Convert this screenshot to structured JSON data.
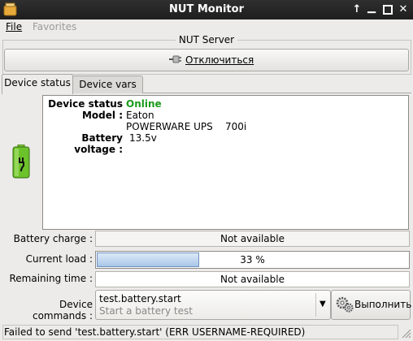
{
  "window": {
    "title": "NUT Monitor"
  },
  "menu": {
    "file": "File",
    "favorites": "Favorites"
  },
  "server": {
    "legend": "NUT Server",
    "disconnect_label": "Отключиться"
  },
  "tabs": [
    {
      "label": "Device status",
      "active": true
    },
    {
      "label": "Device vars",
      "active": false
    }
  ],
  "status": {
    "device_status_label": "Device status :",
    "device_status_value": "Online",
    "model_label": "Model :",
    "model_line1": "Eaton",
    "model_line2": "POWERWARE UPS    700i",
    "battery_voltage_label": "Battery voltage :",
    "battery_voltage_value": "13.5v"
  },
  "rows": {
    "battery_charge_label": "Battery charge :",
    "battery_charge_value": "Not available",
    "current_load_label": "Current load :",
    "current_load_value": "33 %",
    "current_load_percent": 33,
    "remaining_time_label": "Remaining time :",
    "remaining_time_value": "Not available",
    "device_commands_label": "Device commands :"
  },
  "command": {
    "name": "test.battery.start",
    "description": "Start a battery test",
    "execute_label": "Выполнить"
  },
  "statusbar": {
    "text": "Failed to send 'test.battery.start' (ERR USERNAME-REQUIRED)"
  },
  "colors": {
    "online": "#1a9a1a",
    "titlebar": "#262626"
  },
  "icons": [
    "window-app-icon",
    "maximize-icon",
    "minimize-icon",
    "restore-icon",
    "close-icon",
    "plug-icon",
    "battery-icon",
    "gears-icon",
    "dropdown-arrow-icon",
    "resize-grip-icon"
  ]
}
